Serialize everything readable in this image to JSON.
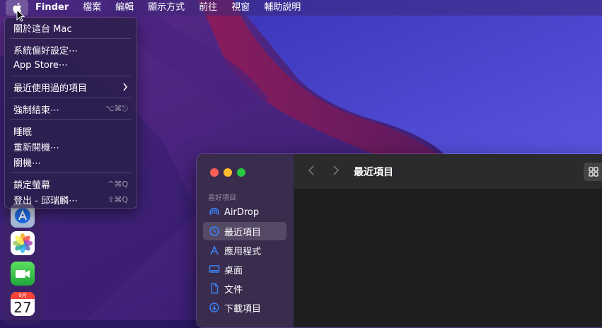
{
  "menubar": {
    "app_name": "Finder",
    "items": [
      "檔案",
      "編輯",
      "顯示方式",
      "前往",
      "視窗",
      "輔助說明"
    ]
  },
  "apple_menu": {
    "about": "關於這台 Mac",
    "system_prefs": "系統偏好設定⋯",
    "app_store": "App Store⋯",
    "recent_items": "最近使用過的項目",
    "force_quit": "強制結束⋯",
    "force_quit_shortcut": "⌥⌘⎋",
    "sleep": "睡眠",
    "restart": "重新開機⋯",
    "shutdown": "關機⋯",
    "lock_screen": "鎖定螢幕",
    "lock_screen_shortcut": "^⌘Q",
    "logout": "登出 - 邱瑞麟⋯",
    "logout_shortcut": "⇧⌘Q"
  },
  "dock": {
    "calendar_month": "9月",
    "calendar_day": "27"
  },
  "finder": {
    "title": "最近項目",
    "sidebar_heading": "喜好項目",
    "sidebar_items": [
      {
        "label": "AirDrop",
        "icon": "airdrop-icon"
      },
      {
        "label": "最近項目",
        "icon": "clock-icon"
      },
      {
        "label": "應用程式",
        "icon": "applications-icon"
      },
      {
        "label": "桌面",
        "icon": "desktop-icon"
      },
      {
        "label": "文件",
        "icon": "document-icon"
      },
      {
        "label": "下載項目",
        "icon": "download-icon"
      }
    ]
  },
  "colors": {
    "accent": "#3b82f6",
    "close": "#ff5f57",
    "minimize": "#febc2e",
    "zoom": "#28c840"
  }
}
